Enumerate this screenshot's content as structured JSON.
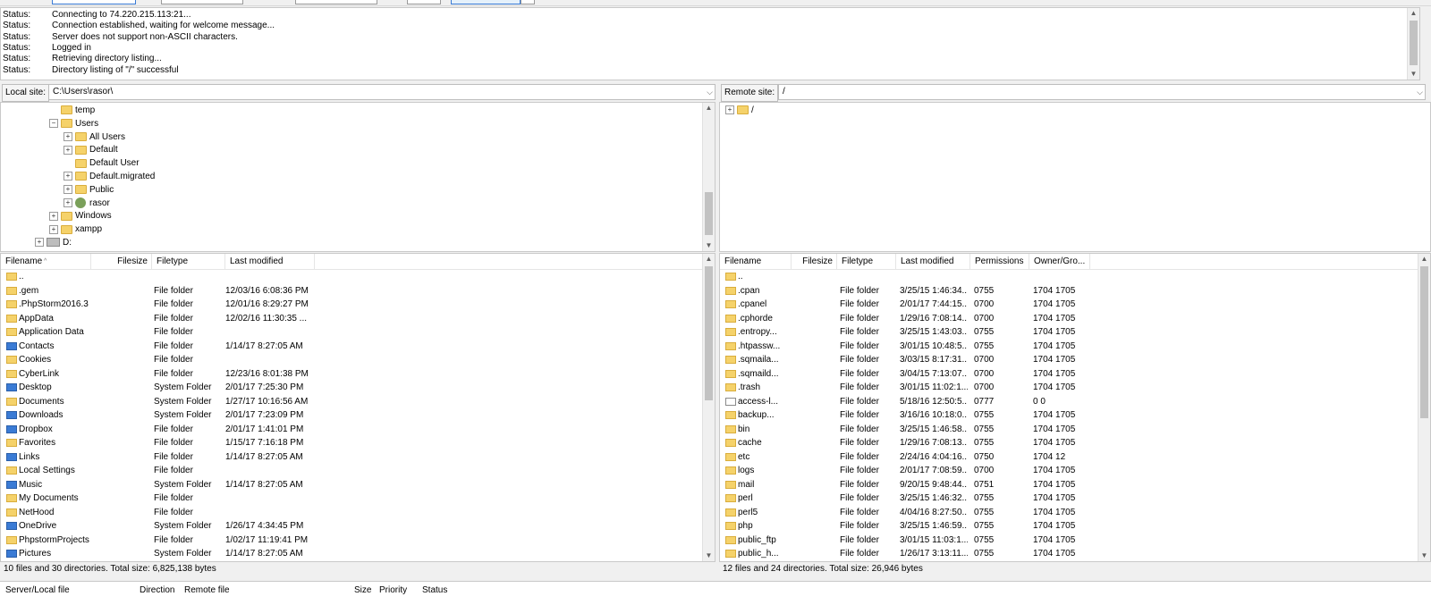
{
  "log": [
    {
      "label": "Status:",
      "text": "Connecting to 74.220.215.113:21..."
    },
    {
      "label": "Status:",
      "text": "Connection established, waiting for welcome message..."
    },
    {
      "label": "Status:",
      "text": "Server does not support non-ASCII characters."
    },
    {
      "label": "Status:",
      "text": "Logged in"
    },
    {
      "label": "Status:",
      "text": "Retrieving directory listing..."
    },
    {
      "label": "Status:",
      "text": "Directory listing of \"/\" successful"
    }
  ],
  "local": {
    "site_label": "Local site:",
    "path": "C:\\Users\\rasor\\",
    "tree": [
      {
        "label": "temp",
        "indent": 1,
        "expander": "",
        "icon": "folder"
      },
      {
        "label": "Users",
        "indent": 1,
        "expander": "-",
        "icon": "folder"
      },
      {
        "label": "All Users",
        "indent": 2,
        "expander": "+",
        "icon": "folder"
      },
      {
        "label": "Default",
        "indent": 2,
        "expander": "+",
        "icon": "folder"
      },
      {
        "label": "Default User",
        "indent": 2,
        "expander": "",
        "icon": "folder"
      },
      {
        "label": "Default.migrated",
        "indent": 2,
        "expander": "+",
        "icon": "folder"
      },
      {
        "label": "Public",
        "indent": 2,
        "expander": "+",
        "icon": "folder"
      },
      {
        "label": "rasor",
        "indent": 2,
        "expander": "+",
        "icon": "user"
      },
      {
        "label": "Windows",
        "indent": 1,
        "expander": "+",
        "icon": "folder"
      },
      {
        "label": "xampp",
        "indent": 1,
        "expander": "+",
        "icon": "folder"
      },
      {
        "label": "D:",
        "indent": 0,
        "expander": "+",
        "icon": "drive"
      }
    ],
    "columns": [
      "Filename",
      "Filesize",
      "Filetype",
      "Last modified"
    ],
    "files": [
      {
        "name": "..",
        "size": "",
        "type": "",
        "modified": "",
        "icon": "folder"
      },
      {
        "name": ".gem",
        "size": "",
        "type": "File folder",
        "modified": "12/03/16 6:08:36 PM",
        "icon": "folder"
      },
      {
        "name": ".PhpStorm2016.3",
        "size": "",
        "type": "File folder",
        "modified": "12/01/16 8:29:27 PM",
        "icon": "folder"
      },
      {
        "name": "AppData",
        "size": "",
        "type": "File folder",
        "modified": "12/02/16 11:30:35 ...",
        "icon": "folder"
      },
      {
        "name": "Application Data",
        "size": "",
        "type": "File folder",
        "modified": "",
        "icon": "folder"
      },
      {
        "name": "Contacts",
        "size": "",
        "type": "File folder",
        "modified": "1/14/17 8:27:05 AM",
        "icon": "sys"
      },
      {
        "name": "Cookies",
        "size": "",
        "type": "File folder",
        "modified": "",
        "icon": "folder"
      },
      {
        "name": "CyberLink",
        "size": "",
        "type": "File folder",
        "modified": "12/23/16 8:01:38 PM",
        "icon": "folder"
      },
      {
        "name": "Desktop",
        "size": "",
        "type": "System Folder",
        "modified": "2/01/17 7:25:30 PM",
        "icon": "sys"
      },
      {
        "name": "Documents",
        "size": "",
        "type": "System Folder",
        "modified": "1/27/17 10:16:56 AM",
        "icon": "folder"
      },
      {
        "name": "Downloads",
        "size": "",
        "type": "System Folder",
        "modified": "2/01/17 7:23:09 PM",
        "icon": "sys"
      },
      {
        "name": "Dropbox",
        "size": "",
        "type": "File folder",
        "modified": "2/01/17 1:41:01 PM",
        "icon": "sys"
      },
      {
        "name": "Favorites",
        "size": "",
        "type": "File folder",
        "modified": "1/15/17 7:16:18 PM",
        "icon": "folder"
      },
      {
        "name": "Links",
        "size": "",
        "type": "File folder",
        "modified": "1/14/17 8:27:05 AM",
        "icon": "sys"
      },
      {
        "name": "Local Settings",
        "size": "",
        "type": "File folder",
        "modified": "",
        "icon": "folder"
      },
      {
        "name": "Music",
        "size": "",
        "type": "System Folder",
        "modified": "1/14/17 8:27:05 AM",
        "icon": "sys"
      },
      {
        "name": "My Documents",
        "size": "",
        "type": "File folder",
        "modified": "",
        "icon": "folder"
      },
      {
        "name": "NetHood",
        "size": "",
        "type": "File folder",
        "modified": "",
        "icon": "folder"
      },
      {
        "name": "OneDrive",
        "size": "",
        "type": "System Folder",
        "modified": "1/26/17 4:34:45 PM",
        "icon": "sys"
      },
      {
        "name": "PhpstormProjects",
        "size": "",
        "type": "File folder",
        "modified": "1/02/17 11:19:41 PM",
        "icon": "folder"
      },
      {
        "name": "Pictures",
        "size": "",
        "type": "System Folder",
        "modified": "1/14/17 8:27:05 AM",
        "icon": "sys"
      }
    ],
    "status": "10 files and 30 directories. Total size: 6,825,138 bytes"
  },
  "remote": {
    "site_label": "Remote site:",
    "path": "/",
    "tree": [
      {
        "label": "/",
        "indent": 0,
        "expander": "+",
        "icon": "folder"
      }
    ],
    "columns": [
      "Filename",
      "Filesize",
      "Filetype",
      "Last modified",
      "Permissions",
      "Owner/Gro..."
    ],
    "files": [
      {
        "name": "..",
        "size": "",
        "type": "",
        "modified": "",
        "perms": "",
        "owner": "",
        "icon": "folder"
      },
      {
        "name": ".cpan",
        "size": "",
        "type": "File folder",
        "modified": "3/25/15 1:46:34...",
        "perms": "0755",
        "owner": "1704 1705",
        "icon": "folder"
      },
      {
        "name": ".cpanel",
        "size": "",
        "type": "File folder",
        "modified": "2/01/17 7:44:15...",
        "perms": "0700",
        "owner": "1704 1705",
        "icon": "folder"
      },
      {
        "name": ".cphorde",
        "size": "",
        "type": "File folder",
        "modified": "1/29/16 7:08:14...",
        "perms": "0700",
        "owner": "1704 1705",
        "icon": "folder"
      },
      {
        "name": ".entropy...",
        "size": "",
        "type": "File folder",
        "modified": "3/25/15 1:43:03...",
        "perms": "0755",
        "owner": "1704 1705",
        "icon": "folder"
      },
      {
        "name": ".htpassw...",
        "size": "",
        "type": "File folder",
        "modified": "3/01/15 10:48:5...",
        "perms": "0755",
        "owner": "1704 1705",
        "icon": "folder"
      },
      {
        "name": ".sqmaila...",
        "size": "",
        "type": "File folder",
        "modified": "3/03/15 8:17:31...",
        "perms": "0700",
        "owner": "1704 1705",
        "icon": "folder"
      },
      {
        "name": ".sqmaild...",
        "size": "",
        "type": "File folder",
        "modified": "3/04/15 7:13:07...",
        "perms": "0700",
        "owner": "1704 1705",
        "icon": "folder"
      },
      {
        "name": ".trash",
        "size": "",
        "type": "File folder",
        "modified": "3/01/15 11:02:1...",
        "perms": "0700",
        "owner": "1704 1705",
        "icon": "folder"
      },
      {
        "name": "access-l...",
        "size": "",
        "type": "File folder",
        "modified": "5/18/16 12:50:5...",
        "perms": "0777",
        "owner": "0 0",
        "icon": "file"
      },
      {
        "name": "backup...",
        "size": "",
        "type": "File folder",
        "modified": "3/16/16 10:18:0...",
        "perms": "0755",
        "owner": "1704 1705",
        "icon": "folder"
      },
      {
        "name": "bin",
        "size": "",
        "type": "File folder",
        "modified": "3/25/15 1:46:58...",
        "perms": "0755",
        "owner": "1704 1705",
        "icon": "folder"
      },
      {
        "name": "cache",
        "size": "",
        "type": "File folder",
        "modified": "1/29/16 7:08:13...",
        "perms": "0755",
        "owner": "1704 1705",
        "icon": "folder"
      },
      {
        "name": "etc",
        "size": "",
        "type": "File folder",
        "modified": "2/24/16 4:04:16...",
        "perms": "0750",
        "owner": "1704 12",
        "icon": "folder"
      },
      {
        "name": "logs",
        "size": "",
        "type": "File folder",
        "modified": "2/01/17 7:08:59...",
        "perms": "0700",
        "owner": "1704 1705",
        "icon": "folder"
      },
      {
        "name": "mail",
        "size": "",
        "type": "File folder",
        "modified": "9/20/15 9:48:44...",
        "perms": "0751",
        "owner": "1704 1705",
        "icon": "folder"
      },
      {
        "name": "perl",
        "size": "",
        "type": "File folder",
        "modified": "3/25/15 1:46:32...",
        "perms": "0755",
        "owner": "1704 1705",
        "icon": "folder"
      },
      {
        "name": "perl5",
        "size": "",
        "type": "File folder",
        "modified": "4/04/16 8:27:50...",
        "perms": "0755",
        "owner": "1704 1705",
        "icon": "folder"
      },
      {
        "name": "php",
        "size": "",
        "type": "File folder",
        "modified": "3/25/15 1:46:59...",
        "perms": "0755",
        "owner": "1704 1705",
        "icon": "folder"
      },
      {
        "name": "public_ftp",
        "size": "",
        "type": "File folder",
        "modified": "3/01/15 11:03:1...",
        "perms": "0755",
        "owner": "1704 1705",
        "icon": "folder"
      },
      {
        "name": "public_h...",
        "size": "",
        "type": "File folder",
        "modified": "1/26/17 3:13:11...",
        "perms": "0755",
        "owner": "1704 1705",
        "icon": "folder"
      }
    ],
    "status": "12 files and 24 directories. Total size: 26,946 bytes"
  },
  "queue": {
    "columns": [
      "Server/Local file",
      "Direction",
      "Remote file",
      "Size",
      "Priority",
      "Status"
    ]
  }
}
